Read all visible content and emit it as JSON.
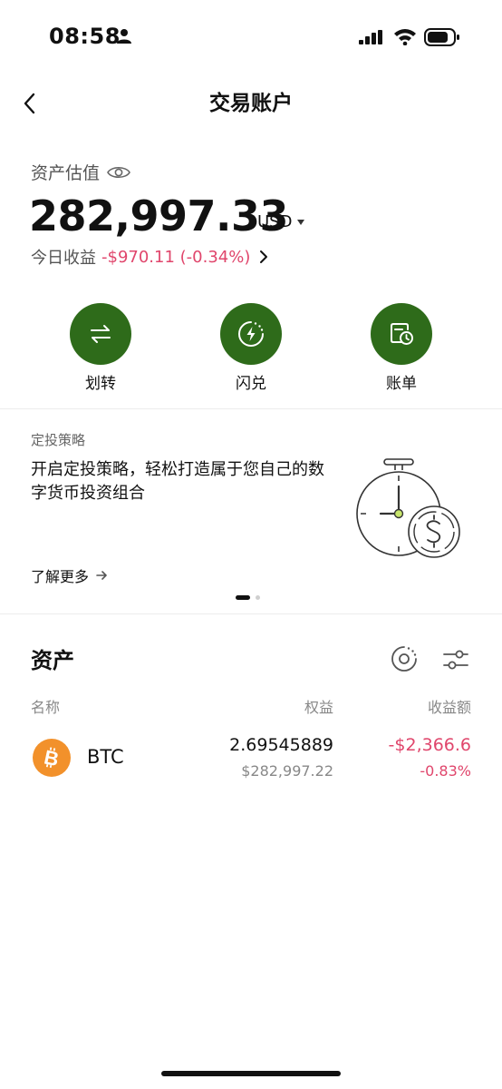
{
  "status_bar": {
    "time": "08:58"
  },
  "header": {
    "title": "交易账户"
  },
  "summary": {
    "label": "资产估值",
    "total_value": "282,997.33",
    "currency": "USD",
    "pnl_label": "今日收益",
    "pnl_value": "-$970.11 (-0.34%)"
  },
  "actions": [
    {
      "label": "划转",
      "icon": "transfer-icon"
    },
    {
      "label": "闪兑",
      "icon": "flash-convert-icon"
    },
    {
      "label": "账单",
      "icon": "bill-icon"
    }
  ],
  "promo": {
    "tag": "定投策略",
    "text": "开启定投策略，轻松打造属于您自己的数字货币投资组合",
    "link": "了解更多",
    "slides": 2,
    "active_slide": 1
  },
  "assets": {
    "title": "资产",
    "columns": {
      "name": "名称",
      "equity": "权益",
      "pnl": "收益额"
    },
    "rows": [
      {
        "symbol": "BTC",
        "amount": "2.69545889",
        "usd_value": "$282,997.22",
        "pnl": "-$2,366.6",
        "pnl_percent": "-0.83%"
      }
    ]
  },
  "colors": {
    "accent": "#2e6b1a",
    "negative": "#e0466c",
    "btc": "#f2912b"
  }
}
